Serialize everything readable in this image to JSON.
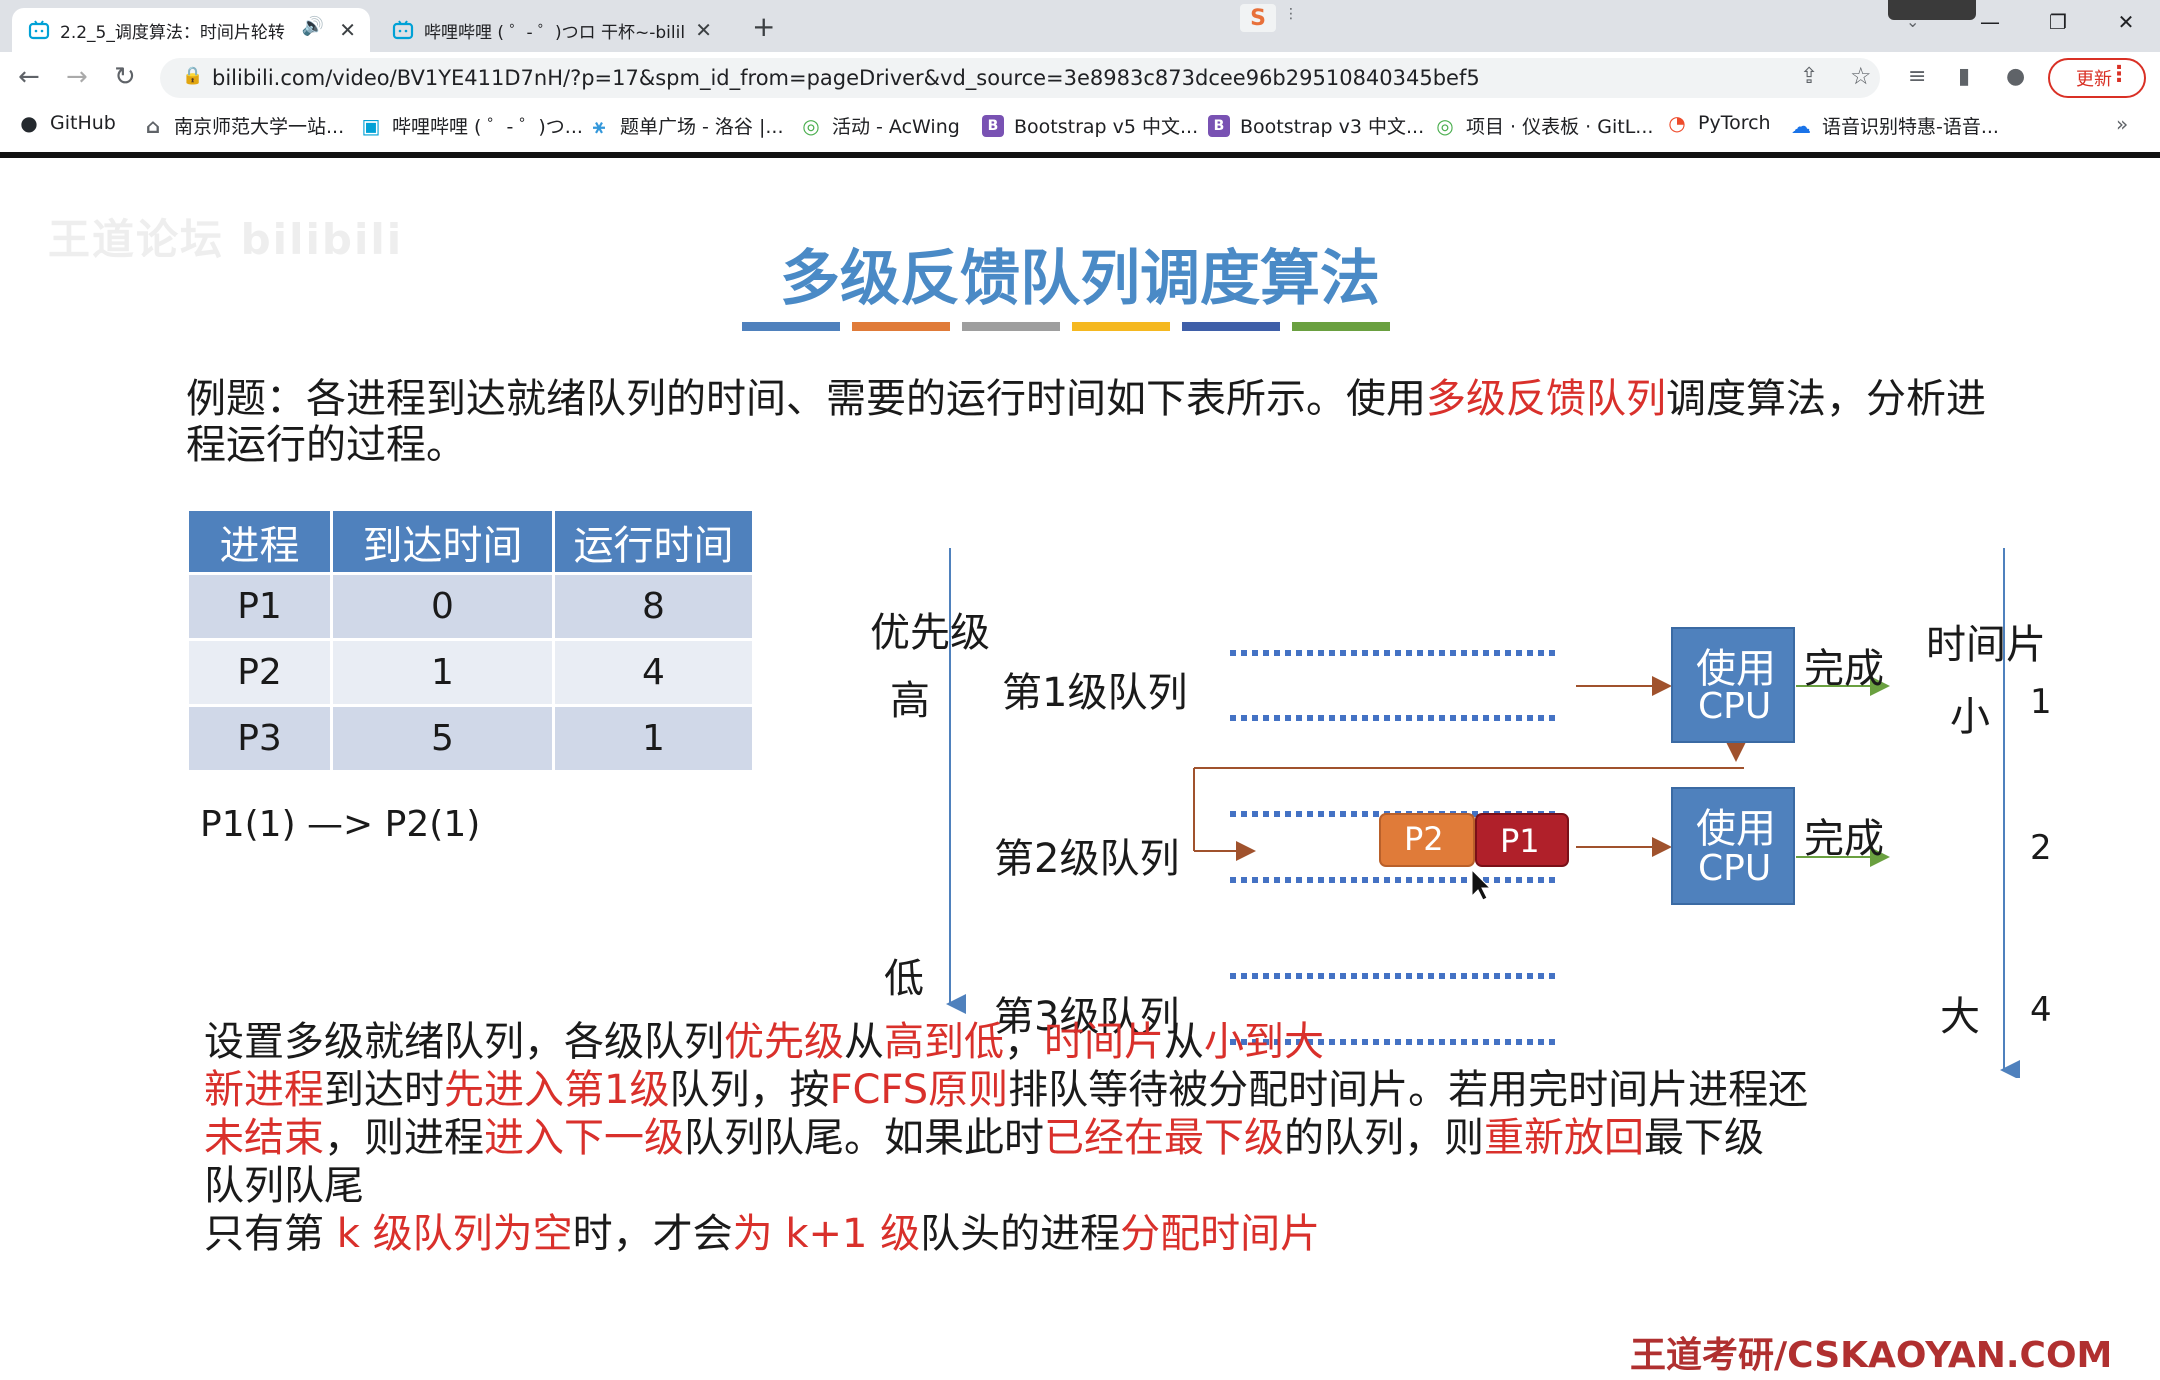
{
  "browser": {
    "tabs": [
      {
        "title": "2.2_5_调度算法：时间片轮转",
        "active": true
      },
      {
        "title": "哔哩哔哩 ( ゜- ゜)つロ 干杯~-bilil",
        "active": false
      }
    ],
    "url": "bilibili.com/video/BV1YE411D7nH/?p=17&spm_id_from=pageDriver&vd_source=3e8983c873dcee96b29510840345bef5",
    "update_label": "更新",
    "bookmarks": [
      {
        "label": "GitHub",
        "icon": "github-icon"
      },
      {
        "label": "南京师范大学一站...",
        "icon": "home-icon"
      },
      {
        "label": "哔哩哔哩 ( ゜- ゜)つ...",
        "icon": "bilibili-icon"
      },
      {
        "label": "题单广场 - 洛谷 |...",
        "icon": "luogu-icon"
      },
      {
        "label": "活动 - AcWing",
        "icon": "acwing-icon"
      },
      {
        "label": "Bootstrap v5 中文...",
        "icon": "bootstrap-icon"
      },
      {
        "label": "Bootstrap v3 中文...",
        "icon": "bootstrap-icon"
      },
      {
        "label": "项目 · 仪表板 · GitL...",
        "icon": "gitlab-icon"
      },
      {
        "label": "PyTorch",
        "icon": "pytorch-icon"
      },
      {
        "label": "语音识别特惠-语音...",
        "icon": "cloud-icon"
      }
    ]
  },
  "slide": {
    "watermark": "王道论坛 bilibili",
    "title": "多级反馈队列调度算法",
    "title_bar_colors": [
      "#4f81bd",
      "#e07b39",
      "#9e9e9e",
      "#f5b820",
      "#3f5fa8",
      "#6aa040"
    ],
    "intro_1": "例题：各进程到达就绪队列的时间、需要的运行时间如下表所示。使用",
    "intro_red": "多级反馈队列",
    "intro_2": "调度算法，分析进程运行的过程。",
    "table": {
      "headers": [
        "进程",
        "到达时间",
        "运行时间"
      ],
      "rows": [
        [
          "P1",
          "0",
          "8"
        ],
        [
          "P2",
          "1",
          "4"
        ],
        [
          "P3",
          "5",
          "1"
        ]
      ]
    },
    "sequence": "P1(1) —> P2(1)",
    "diagram": {
      "priority_label": "优先级",
      "high": "高",
      "low": "低",
      "queues": [
        "第1级队列",
        "第2级队列",
        "第3级队列"
      ],
      "cpu_line1": "使用",
      "cpu_line2": "CPU",
      "done": "完成",
      "slice_label": "时间片",
      "small": "小",
      "large": "大",
      "slices": [
        "1",
        "2",
        "4"
      ],
      "p2": "P2",
      "p1": "P1"
    },
    "notes": [
      [
        [
          "设置多级就绪队列，各级队列",
          false
        ],
        [
          "优先级",
          true
        ],
        [
          "从",
          false
        ],
        [
          "高到低",
          true
        ],
        [
          "，",
          false
        ],
        [
          "时间片",
          true
        ],
        [
          "从",
          false
        ],
        [
          "小到大",
          true
        ]
      ],
      [
        [
          "新进程",
          true
        ],
        [
          "到达时",
          false
        ],
        [
          "先进入第1级",
          true
        ],
        [
          "队列，按",
          false
        ],
        [
          "FCFS原则",
          true
        ],
        [
          "排队等待被分配时间片。若用完时间片进程还",
          false
        ]
      ],
      [
        [
          "未结束",
          true
        ],
        [
          "，则进程",
          false
        ],
        [
          "进入下一级",
          true
        ],
        [
          "队列队尾。如果此时",
          false
        ],
        [
          "已经在最下级",
          true
        ],
        [
          "的队列，则",
          false
        ],
        [
          "重新放回",
          true
        ],
        [
          "最下级",
          false
        ]
      ],
      [
        [
          "队列队尾",
          false
        ]
      ],
      [
        [
          "只有第 ",
          false
        ],
        [
          "k 级队列为空",
          true
        ],
        [
          "时，才会",
          false
        ],
        [
          "为 k+1 级",
          true
        ],
        [
          "队头的进程",
          false
        ],
        [
          "分配时间片",
          true
        ]
      ]
    ],
    "brand": "王道考研/CSKAOYAN.COM"
  }
}
